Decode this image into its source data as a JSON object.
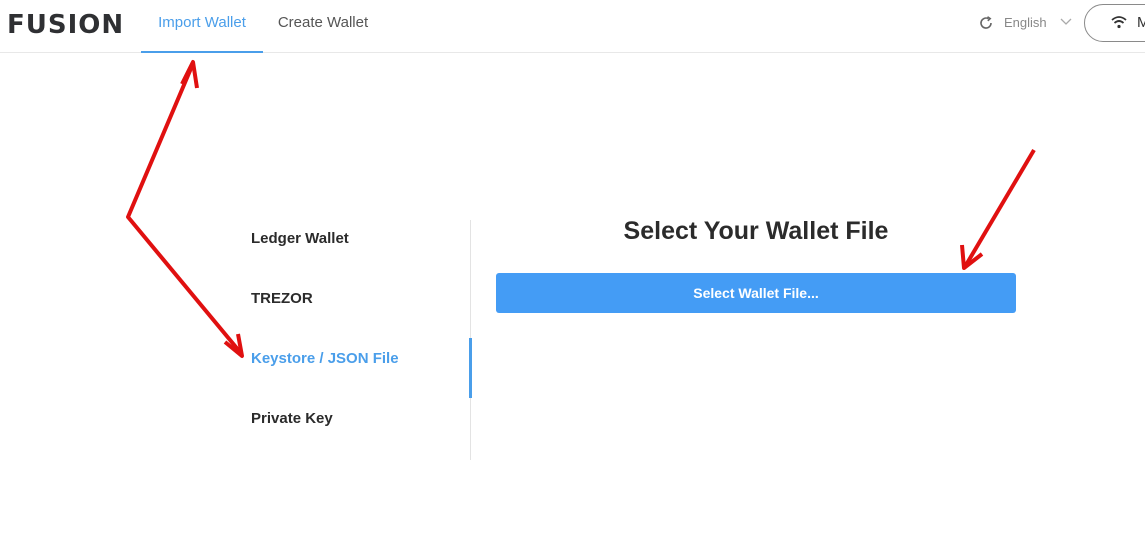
{
  "header": {
    "logo": "FUSION",
    "tabs": [
      {
        "label": "Import Wallet",
        "active": true
      },
      {
        "label": "Create Wallet",
        "active": false
      }
    ],
    "language": "English",
    "network_label": "M"
  },
  "sidebar": {
    "items": [
      {
        "label": "Ledger Wallet",
        "active": false
      },
      {
        "label": "TREZOR",
        "active": false
      },
      {
        "label": "Keystore / JSON File",
        "active": true
      },
      {
        "label": "Private Key",
        "active": false
      }
    ]
  },
  "main": {
    "title": "Select Your Wallet File",
    "select_button_label": "Select Wallet File..."
  },
  "colors": {
    "accent": "#4a9eea",
    "button": "#449cf5",
    "annotation_arrow": "#e01010"
  },
  "icons": {
    "refresh": "refresh-icon",
    "dropdown": "chevron-down-icon",
    "network": "wifi-icon"
  }
}
